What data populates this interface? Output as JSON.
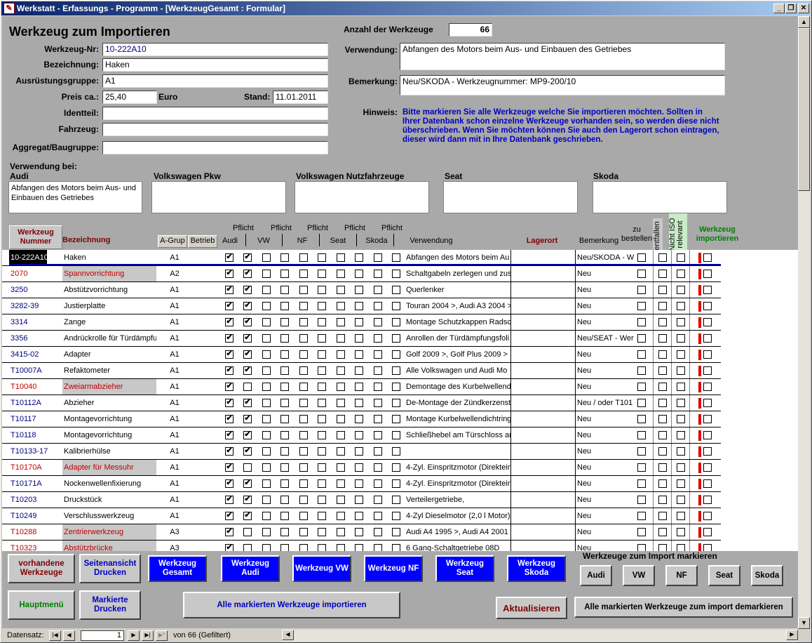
{
  "window": {
    "title": "Werkstatt - Erfassungs - Programm - [WerkzeugGesamt : Formular]",
    "app_icon": "form-icon"
  },
  "form": {
    "heading": "Werkzeug zum Importieren",
    "anzahl_label": "Anzahl der Werkzeuge",
    "anzahl_value": "66",
    "werkzeug_nr_label": "Werkzeug-Nr:",
    "werkzeug_nr": "10-222A10",
    "bezeichnung_label": "Bezeichnung:",
    "bezeichnung": "Haken",
    "ausruestungsgruppe_label": "Ausrüstungsgruppe:",
    "ausruestungsgruppe": "A1",
    "preis_label": "Preis ca.:",
    "preis": "25,40",
    "waehrung": "Euro",
    "stand_label": "Stand:",
    "stand": "11.01.2011",
    "identteil_label": "Identteil:",
    "identteil": "",
    "fahrzeug_label": "Fahrzeug:",
    "fahrzeug": "",
    "aggregat_label": "Aggregat/Baugruppe:",
    "aggregat": "",
    "verwendung_label": "Verwendung:",
    "verwendung": "Abfangen des Motors beim Aus- und Einbauen des Getriebes",
    "bemerkung_label": "Bemerkung:",
    "bemerkung": "Neu/SKODA - Werkzeugnummer: MP9-200/10",
    "hinweis_label": "Hinweis:",
    "hinweis": "Bitte markieren Sie alle Werkzeuge welche Sie importieren möchten. Sollten in Ihrer Datenbank schon einzelne Werkzeuge vorhanden sein, so werden diese nicht überschrieben. Wenn Sie möchten können Sie auch den Lagerort schon eintragen, dieser wird dann mit in Ihre Datenbank geschrieben.",
    "verwendung_bei_label": "Verwendung bei:",
    "marken": [
      {
        "label": "Audi",
        "text": "Abfangen des Motors beim Aus- und Einbauen des Getriebes"
      },
      {
        "label": "Volkswagen Pkw",
        "text": ""
      },
      {
        "label": "Volkswagen Nutzfahrzeuge",
        "text": ""
      },
      {
        "label": "Seat",
        "text": ""
      },
      {
        "label": "Skoda",
        "text": ""
      }
    ]
  },
  "columns": {
    "nummer": "Werkzeug Nummer",
    "bezeichnung": "Bezeichnung",
    "agrup": "A-Grup",
    "betrieb": "Betrieb",
    "pflicht": "Pflicht",
    "audi": "Audi",
    "vw": "VW",
    "nf": "NF",
    "seat": "Seat",
    "skoda": "Skoda",
    "verwendung": "Verwendung",
    "lagerort": "Lagerort",
    "bemerkung": "Bemerkung",
    "zu_bestellen": "zu bestellen",
    "entfallen": "entfallen",
    "nicht_iso": "Nicht ISO relevant",
    "importieren": "Werkzeug importieren"
  },
  "rows": [
    {
      "nr": "10-222A10",
      "bez": "Haken",
      "gr": "A1",
      "checks": [
        1,
        1,
        0,
        0,
        0,
        0,
        0,
        0,
        0,
        0
      ],
      "verw": "Abfangen des Motors beim Au",
      "lag": "",
      "bem": "Neu/SKODA - W",
      "red": false
    },
    {
      "nr": "2070",
      "bez": "Spannvorrichtung",
      "gr": "A2",
      "checks": [
        1,
        1,
        0,
        0,
        0,
        0,
        0,
        0,
        0,
        0
      ],
      "verw": "Schaltgabeln zerlegen und zus",
      "lag": "",
      "bem": "Neu",
      "red": true
    },
    {
      "nr": "3250",
      "bez": "Abstützvorrichtung",
      "gr": "A1",
      "checks": [
        1,
        1,
        0,
        0,
        0,
        0,
        0,
        0,
        0,
        0
      ],
      "verw": "Querlenker",
      "lag": "",
      "bem": "Neu",
      "red": false
    },
    {
      "nr": "3282-39",
      "bez": "Justierplatte",
      "gr": "A1",
      "checks": [
        1,
        1,
        0,
        0,
        0,
        0,
        0,
        0,
        0,
        0
      ],
      "verw": "Touran 2004 >, Audi A3 2004 >",
      "lag": "",
      "bem": "Neu",
      "red": false
    },
    {
      "nr": "3314",
      "bez": "Zange",
      "gr": "A1",
      "checks": [
        1,
        1,
        0,
        0,
        0,
        0,
        0,
        0,
        0,
        0
      ],
      "verw": "Montage Schutzkappen Radsc",
      "lag": "",
      "bem": "Neu",
      "red": false
    },
    {
      "nr": "3356",
      "bez": "Andrückrolle für Türdämpfur",
      "gr": "A1",
      "checks": [
        1,
        1,
        0,
        0,
        0,
        0,
        0,
        0,
        0,
        0
      ],
      "verw": "Anrollen der Türdämpfungsfoli",
      "lag": "",
      "bem": "Neu/SEAT - Wer",
      "red": false
    },
    {
      "nr": "3415-02",
      "bez": "Adapter",
      "gr": "A1",
      "checks": [
        1,
        1,
        0,
        0,
        0,
        0,
        0,
        0,
        0,
        0
      ],
      "verw": "Golf  2009 >, Golf Plus  2009 >",
      "lag": "",
      "bem": "Neu",
      "red": false
    },
    {
      "nr": "T10007A",
      "bez": "Refaktometer",
      "gr": "A1",
      "checks": [
        1,
        1,
        0,
        0,
        0,
        0,
        0,
        0,
        0,
        0
      ],
      "verw": "Alle Volkswagen und Audi Mo",
      "lag": "",
      "bem": "Neu",
      "red": false
    },
    {
      "nr": "T10040",
      "bez": "Zweiarmabzieher",
      "gr": "A1",
      "checks": [
        1,
        0,
        0,
        0,
        0,
        0,
        0,
        0,
        0,
        0
      ],
      "verw": "Demontage des Kurbelwellend",
      "lag": "",
      "bem": "Neu",
      "red": true
    },
    {
      "nr": "T10112A",
      "bez": "Abzieher",
      "gr": "A1",
      "checks": [
        1,
        1,
        0,
        0,
        0,
        0,
        0,
        0,
        0,
        0
      ],
      "verw": "De-Montage der Zündkerzenst",
      "lag": "",
      "bem": "Neu / oder T101",
      "red": false
    },
    {
      "nr": "T10117",
      "bez": "Montagevorrichtung",
      "gr": "A1",
      "checks": [
        1,
        1,
        0,
        0,
        0,
        0,
        0,
        0,
        0,
        0
      ],
      "verw": "Montage Kurbelwellendichtring",
      "lag": "",
      "bem": "Neu",
      "red": false
    },
    {
      "nr": "T10118",
      "bez": "Montagevorrichtung",
      "gr": "A1",
      "checks": [
        1,
        1,
        0,
        0,
        0,
        0,
        0,
        0,
        0,
        0
      ],
      "verw": "Schließhebel am Türschloss ar",
      "lag": "",
      "bem": "Neu",
      "red": false
    },
    {
      "nr": "T10133-17",
      "bez": "Kalibrierhülse",
      "gr": "A1",
      "checks": [
        1,
        1,
        0,
        0,
        0,
        0,
        0,
        0,
        0,
        0
      ],
      "verw": "",
      "lag": "",
      "bem": "Neu",
      "red": false
    },
    {
      "nr": "T10170A",
      "bez": "Adapter für Messuhr",
      "gr": "A1",
      "checks": [
        1,
        0,
        0,
        0,
        0,
        0,
        0,
        0,
        0,
        0
      ],
      "verw": "4-Zyl. Einspritzmotor (Direktein",
      "lag": "",
      "bem": "Neu",
      "red": true
    },
    {
      "nr": "T10171A",
      "bez": "Nockenwellenfixierung",
      "gr": "A1",
      "checks": [
        1,
        1,
        0,
        0,
        0,
        0,
        0,
        0,
        0,
        0
      ],
      "verw": "4-Zyl. Einspritzmotor (Direktein",
      "lag": "",
      "bem": "Neu",
      "red": false
    },
    {
      "nr": "T10203",
      "bez": "Druckstück",
      "gr": "A1",
      "checks": [
        1,
        1,
        0,
        0,
        0,
        0,
        0,
        0,
        0,
        0
      ],
      "verw": "Verteilergetriebe,",
      "lag": "",
      "bem": "Neu",
      "red": false
    },
    {
      "nr": "T10249",
      "bez": "Verschlusswerkzeug",
      "gr": "A1",
      "checks": [
        1,
        1,
        0,
        0,
        0,
        0,
        0,
        0,
        0,
        0
      ],
      "verw": "4-Zyl Dieselmotor (2,0 l Motor)",
      "lag": "",
      "bem": "Neu",
      "red": false
    },
    {
      "nr": "T10288",
      "bez": "Zentrierwerkzeug",
      "gr": "A3",
      "checks": [
        1,
        0,
        0,
        0,
        0,
        0,
        0,
        0,
        0,
        0
      ],
      "verw": "Audi A4 1995 >, Audi A4 2001",
      "lag": "",
      "bem": "Neu",
      "red": true
    },
    {
      "nr": "T10323",
      "bez": "Abstützbrücke",
      "gr": "A3",
      "checks": [
        1,
        0,
        0,
        0,
        0,
        0,
        0,
        0,
        0,
        0
      ],
      "verw": "6 Gang-Schaltgetriebe 08D",
      "lag": "",
      "bem": "Neu",
      "red": true
    }
  ],
  "buttons": {
    "vorhandene": "vorhandene Werkzeuge",
    "seitenansicht": "Seitenansicht Drucken",
    "gesamt": "Werkzeug Gesamt",
    "audi": "Werkzeug Audi",
    "vw": "Werkzeug VW",
    "nf": "Werkzeug NF",
    "seat": "Werkzeug Seat",
    "skoda": "Werkzeug Skoda",
    "import_markieren_label": "Werkzeuge zum Import markieren",
    "mark_audi": "Audi",
    "mark_vw": "VW",
    "mark_nf": "NF",
    "mark_seat": "Seat",
    "mark_skoda": "Skoda",
    "hauptmenue": "Hauptmenü",
    "markierte_drucken": "Markierte Drucken",
    "importieren": "Alle markierten Werkzeuge importieren",
    "aktualisieren": "Aktualisieren",
    "demarkieren": "Alle markierten Werkzeuge zum import demarkieren"
  },
  "status": {
    "datensatz_label": "Datensatz:",
    "current": "1",
    "of_text": "von  66 (Gefiltert)"
  },
  "colors": {
    "title_bar": "#0a246a",
    "red_text": "#c00000",
    "navy_text": "#000080",
    "blue_button": "#0000ff",
    "green_text": "#008000"
  }
}
